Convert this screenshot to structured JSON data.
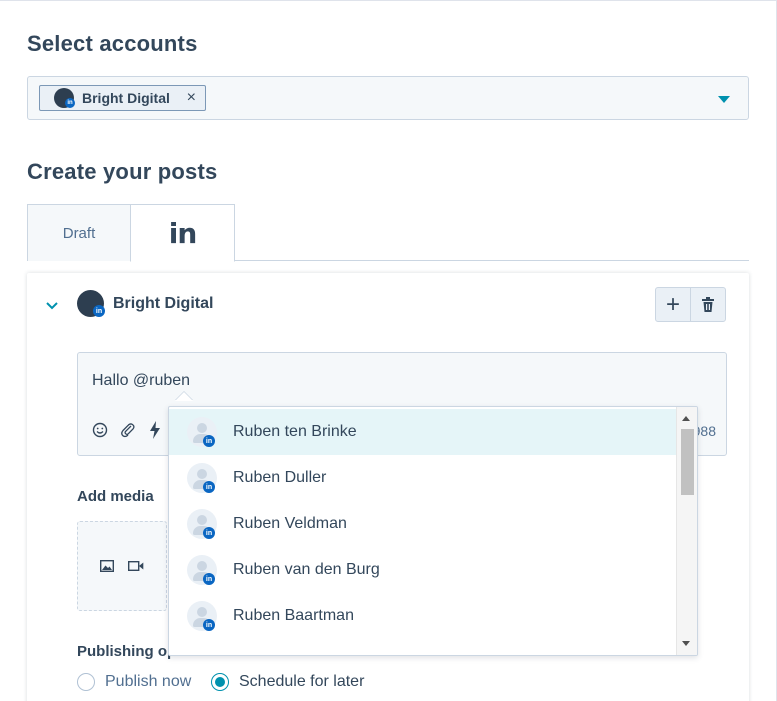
{
  "select_accounts": {
    "heading": "Select accounts",
    "selected_chip": "Bright Digital",
    "chip_close": "×"
  },
  "create_posts": {
    "heading": "Create your posts",
    "tabs": [
      {
        "label": "Draft"
      },
      {
        "label": "in",
        "icon": "linkedin-icon"
      }
    ]
  },
  "post": {
    "collapse_icon": "chevron-down-icon",
    "account_name": "Bright Digital",
    "add_button_label": "+",
    "editor_text": "Hallo @ruben",
    "char_count": "2988",
    "add_media_label": "Add media",
    "publishing_label": "Publishing options",
    "radio_publish_now": "Publish now",
    "radio_schedule": "Schedule for later",
    "schedule_selected": true
  },
  "mentions": {
    "items": [
      {
        "name": "Ruben ten Brinke"
      },
      {
        "name": "Ruben Duller"
      },
      {
        "name": "Ruben Veldman"
      },
      {
        "name": "Ruben van den Burg"
      },
      {
        "name": "Ruben Baartman"
      }
    ]
  },
  "colors": {
    "accent": "#0091ae",
    "text": "#33475b",
    "linkedin": "#0a66c2",
    "highlight": "#e5f5f8"
  }
}
